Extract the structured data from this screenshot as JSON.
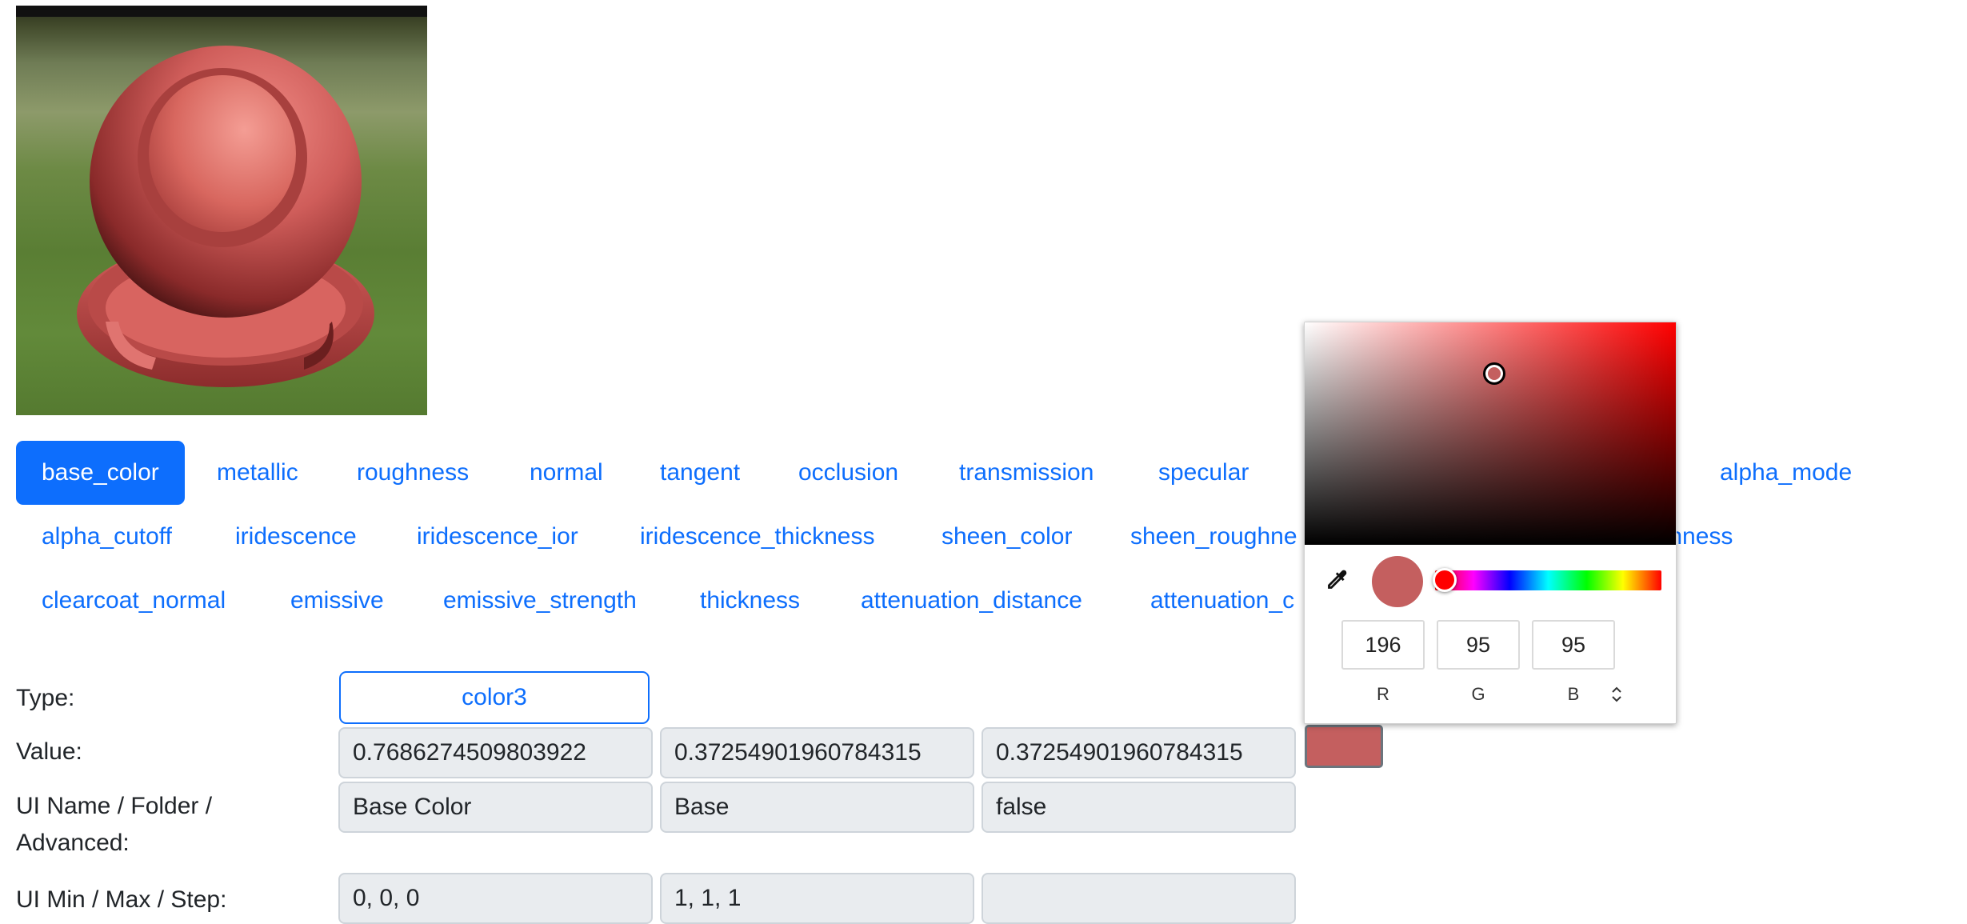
{
  "tabs": [
    {
      "label": "base_color",
      "active": true
    },
    {
      "label": "metallic"
    },
    {
      "label": "roughness"
    },
    {
      "label": "normal"
    },
    {
      "label": "tangent"
    },
    {
      "label": "occlusion"
    },
    {
      "label": "transmission"
    },
    {
      "label": "specular"
    },
    {
      "label": "alpha_mode"
    },
    {
      "label": "alpha_cutoff"
    },
    {
      "label": "iridescence"
    },
    {
      "label": "iridescence_ior"
    },
    {
      "label": "iridescence_thickness"
    },
    {
      "label": "sheen_color"
    },
    {
      "label": "sheen_roughne"
    },
    {
      "label": "ughness"
    },
    {
      "label": "clearcoat_normal"
    },
    {
      "label": "emissive"
    },
    {
      "label": "emissive_strength"
    },
    {
      "label": "thickness"
    },
    {
      "label": "attenuation_distance"
    },
    {
      "label": "attenuation_c"
    }
  ],
  "form": {
    "type_label": "Type:",
    "type_value": "color3",
    "value_label": "Value:",
    "value": [
      "0.7686274509803922",
      "0.37254901960784315",
      "0.37254901960784315"
    ],
    "ui_label_line1": "UI Name / Folder /",
    "ui_label_line2": "Advanced:",
    "ui_values": [
      "Base Color",
      "Base",
      "false"
    ],
    "minmax_label": "UI Min / Max / Step:",
    "minmax_values": [
      "0, 0, 0",
      "1, 1, 1",
      ""
    ]
  },
  "picker": {
    "r": "196",
    "g": "95",
    "b": "95",
    "r_label": "R",
    "g_label": "G",
    "b_label": "B",
    "current_color": "#c45f5f",
    "hue_color": "#ff0000"
  },
  "colors": {
    "accent": "#0d6efd",
    "field_bg": "#e9ecef",
    "material": "#c45f5f"
  }
}
